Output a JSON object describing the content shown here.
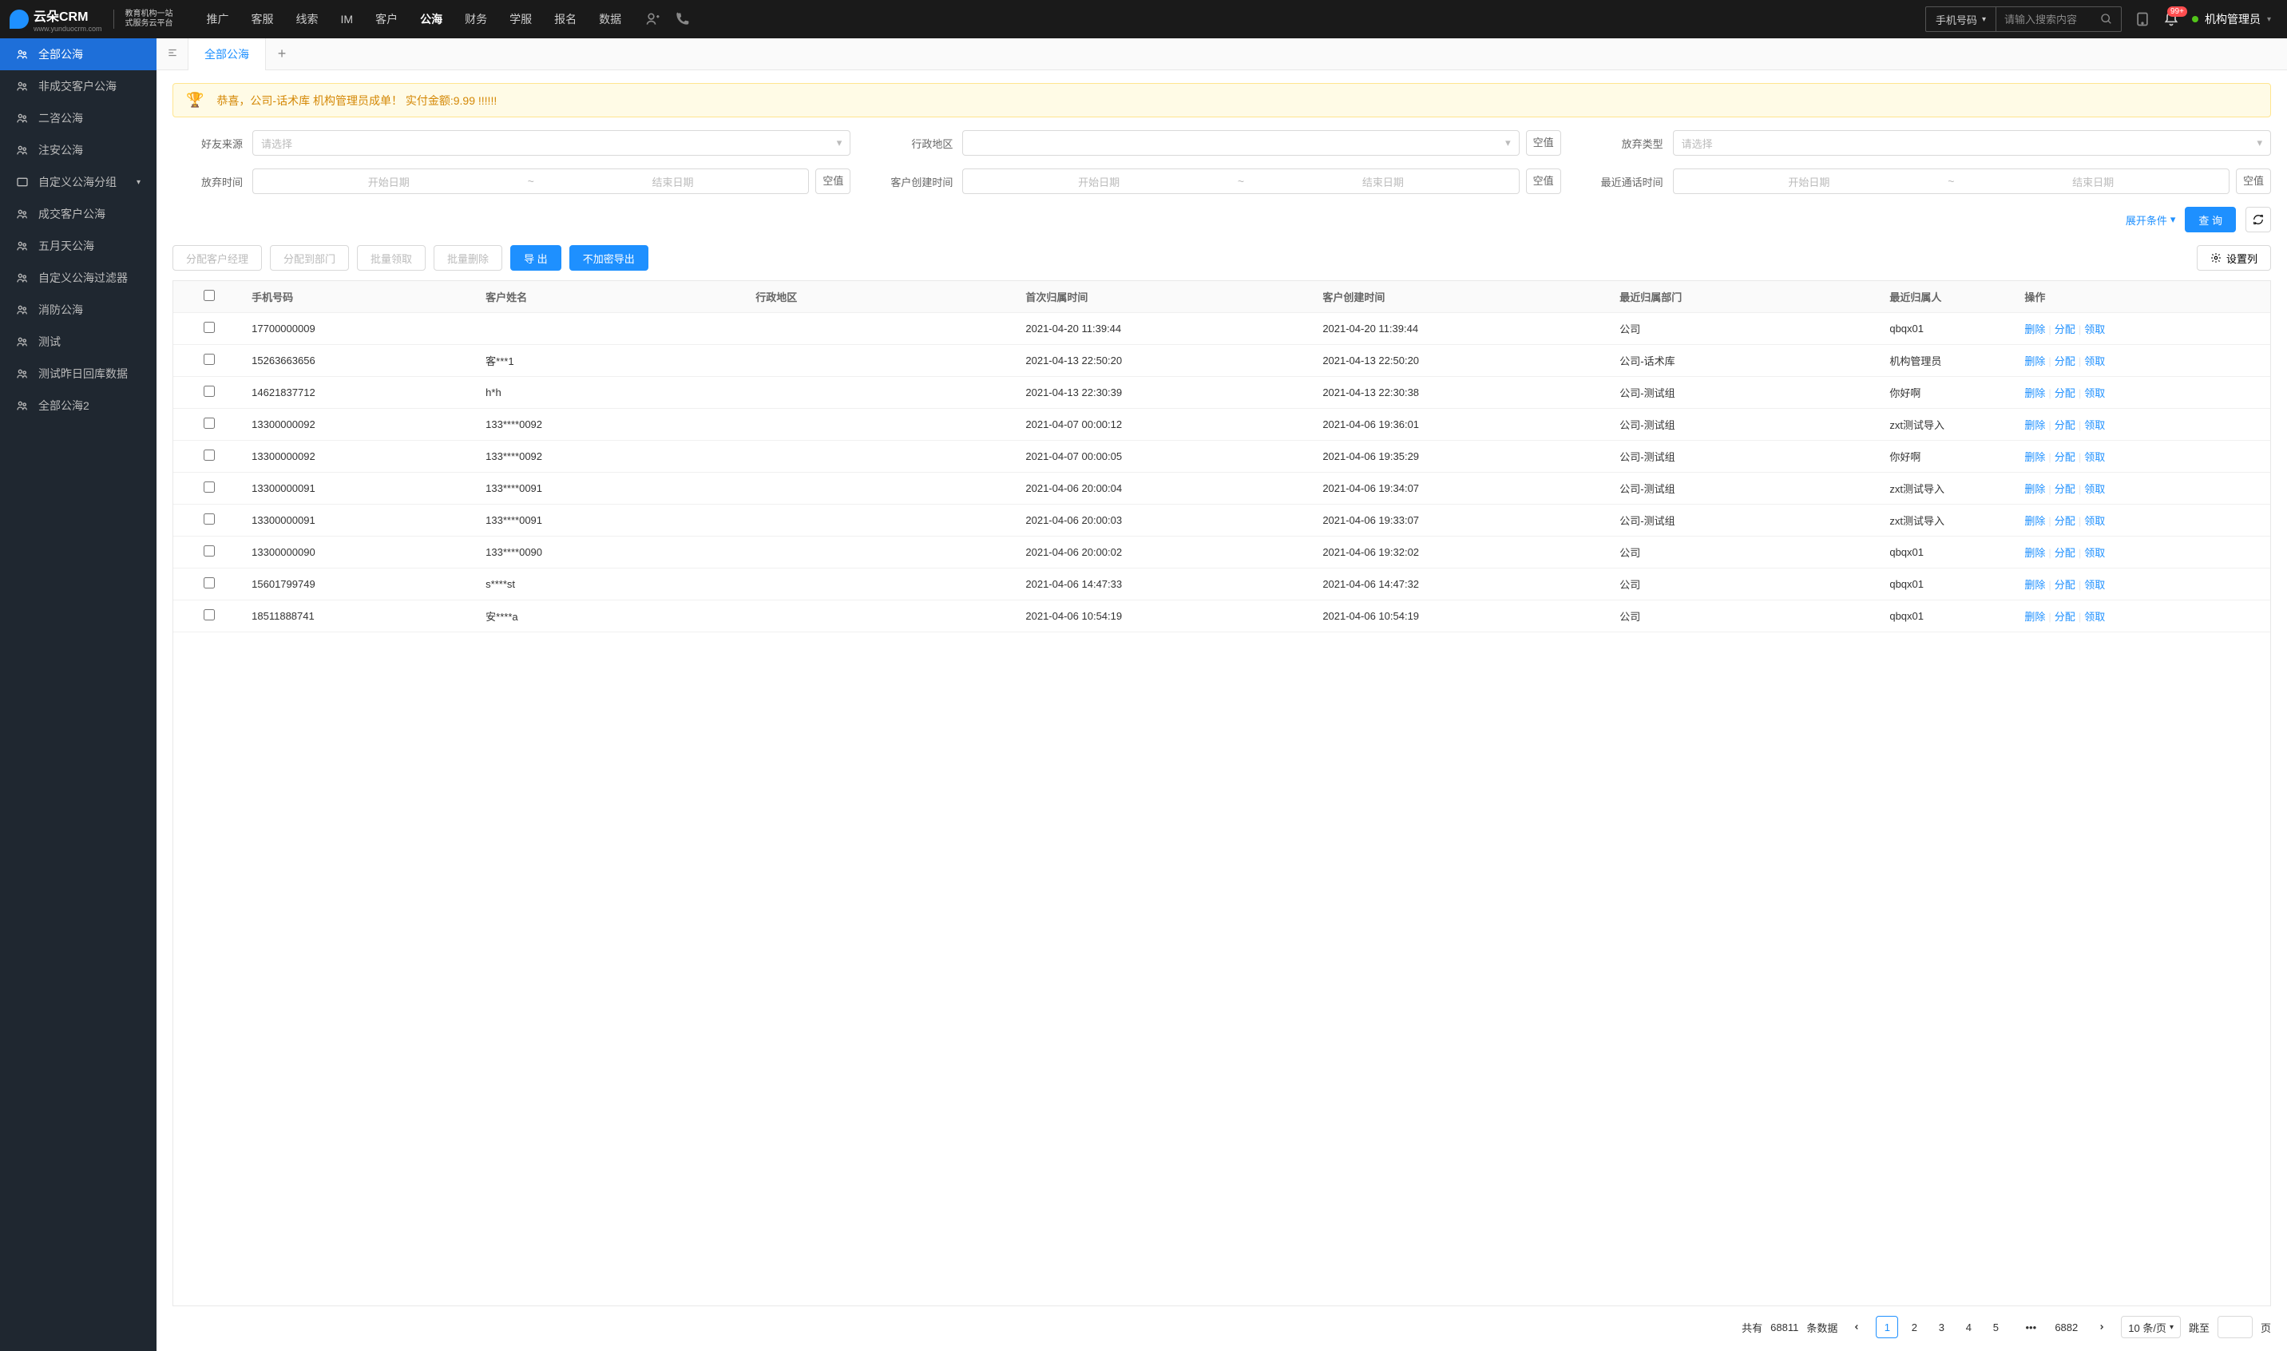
{
  "logo": {
    "brand": "云朵CRM",
    "sub1": "教育机构一站",
    "sub2": "式服务云平台",
    "url": "www.yunduocrm.com"
  },
  "topnav": [
    "推广",
    "客服",
    "线索",
    "IM",
    "客户",
    "公海",
    "财务",
    "学服",
    "报名",
    "数据"
  ],
  "topnav_active": 5,
  "search": {
    "type": "手机号码",
    "placeholder": "请输入搜索内容"
  },
  "notif_count": "99+",
  "user_name": "机构管理员",
  "sidebar": [
    {
      "label": "全部公海",
      "active": true
    },
    {
      "label": "非成交客户公海"
    },
    {
      "label": "二咨公海"
    },
    {
      "label": "注安公海"
    },
    {
      "label": "自定义公海分组",
      "expandable": true
    },
    {
      "label": "成交客户公海"
    },
    {
      "label": "五月天公海"
    },
    {
      "label": "自定义公海过滤器"
    },
    {
      "label": "消防公海"
    },
    {
      "label": "测试"
    },
    {
      "label": "测试昨日回库数据"
    },
    {
      "label": "全部公海2"
    }
  ],
  "tab_label": "全部公海",
  "banner": "恭喜，公司-话术库  机构管理员成单！  实付金额:9.99 !!!!!!",
  "filters": {
    "friend_source": {
      "label": "好友来源",
      "placeholder": "请选择"
    },
    "region": {
      "label": "行政地区",
      "null_btn": "空值"
    },
    "abandon_type": {
      "label": "放弃类型",
      "placeholder": "请选择"
    },
    "abandon_time": {
      "label": "放弃时间",
      "start": "开始日期",
      "end": "结束日期",
      "null_btn": "空值"
    },
    "create_time": {
      "label": "客户创建时间",
      "start": "开始日期",
      "end": "结束日期",
      "null_btn": "空值"
    },
    "last_call": {
      "label": "最近通话时间",
      "start": "开始日期",
      "end": "结束日期",
      "null_btn": "空值"
    }
  },
  "expand_label": "展开条件",
  "query_label": "查 询",
  "toolbar": {
    "assign_mgr": "分配客户经理",
    "assign_dept": "分配到部门",
    "batch_claim": "批量领取",
    "batch_delete": "批量删除",
    "export": "导 出",
    "export_plain": "不加密导出",
    "set_columns": "设置列"
  },
  "columns": [
    "手机号码",
    "客户姓名",
    "行政地区",
    "首次归属时间",
    "客户创建时间",
    "最近归属部门",
    "最近归属人",
    "操作"
  ],
  "actions": {
    "delete": "删除",
    "assign": "分配",
    "claim": "领取"
  },
  "rows": [
    {
      "phone": "17700000009",
      "name": "",
      "region": "",
      "first_time": "2021-04-20 11:39:44",
      "create_time": "2021-04-20 11:39:44",
      "dept": "公司",
      "person": "qbqx01"
    },
    {
      "phone": "15263663656",
      "name": "客***1",
      "region": "",
      "first_time": "2021-04-13 22:50:20",
      "create_time": "2021-04-13 22:50:20",
      "dept": "公司-话术库",
      "person": "机构管理员"
    },
    {
      "phone": "14621837712",
      "name": "h*h",
      "region": "",
      "first_time": "2021-04-13 22:30:39",
      "create_time": "2021-04-13 22:30:38",
      "dept": "公司-测试组",
      "person": "你好啊"
    },
    {
      "phone": "13300000092",
      "name": "133****0092",
      "region": "",
      "first_time": "2021-04-07 00:00:12",
      "create_time": "2021-04-06 19:36:01",
      "dept": "公司-测试组",
      "person": "zxt测试导入"
    },
    {
      "phone": "13300000092",
      "name": "133****0092",
      "region": "",
      "first_time": "2021-04-07 00:00:05",
      "create_time": "2021-04-06 19:35:29",
      "dept": "公司-测试组",
      "person": "你好啊"
    },
    {
      "phone": "13300000091",
      "name": "133****0091",
      "region": "",
      "first_time": "2021-04-06 20:00:04",
      "create_time": "2021-04-06 19:34:07",
      "dept": "公司-测试组",
      "person": "zxt测试导入"
    },
    {
      "phone": "13300000091",
      "name": "133****0091",
      "region": "",
      "first_time": "2021-04-06 20:00:03",
      "create_time": "2021-04-06 19:33:07",
      "dept": "公司-测试组",
      "person": "zxt测试导入"
    },
    {
      "phone": "13300000090",
      "name": "133****0090",
      "region": "",
      "first_time": "2021-04-06 20:00:02",
      "create_time": "2021-04-06 19:32:02",
      "dept": "公司",
      "person": "qbqx01"
    },
    {
      "phone": "15601799749",
      "name": "s****st",
      "region": "",
      "first_time": "2021-04-06 14:47:33",
      "create_time": "2021-04-06 14:47:32",
      "dept": "公司",
      "person": "qbqx01"
    },
    {
      "phone": "18511888741",
      "name": "安****a",
      "region": "",
      "first_time": "2021-04-06 10:54:19",
      "create_time": "2021-04-06 10:54:19",
      "dept": "公司",
      "person": "qbqx01"
    }
  ],
  "pagination": {
    "total_prefix": "共有",
    "total": "68811",
    "total_suffix": "条数据",
    "pages": [
      "1",
      "2",
      "3",
      "4",
      "5"
    ],
    "last": "6882",
    "per_page": "10 条/页",
    "jump_label": "跳至",
    "page_suffix": "页"
  }
}
